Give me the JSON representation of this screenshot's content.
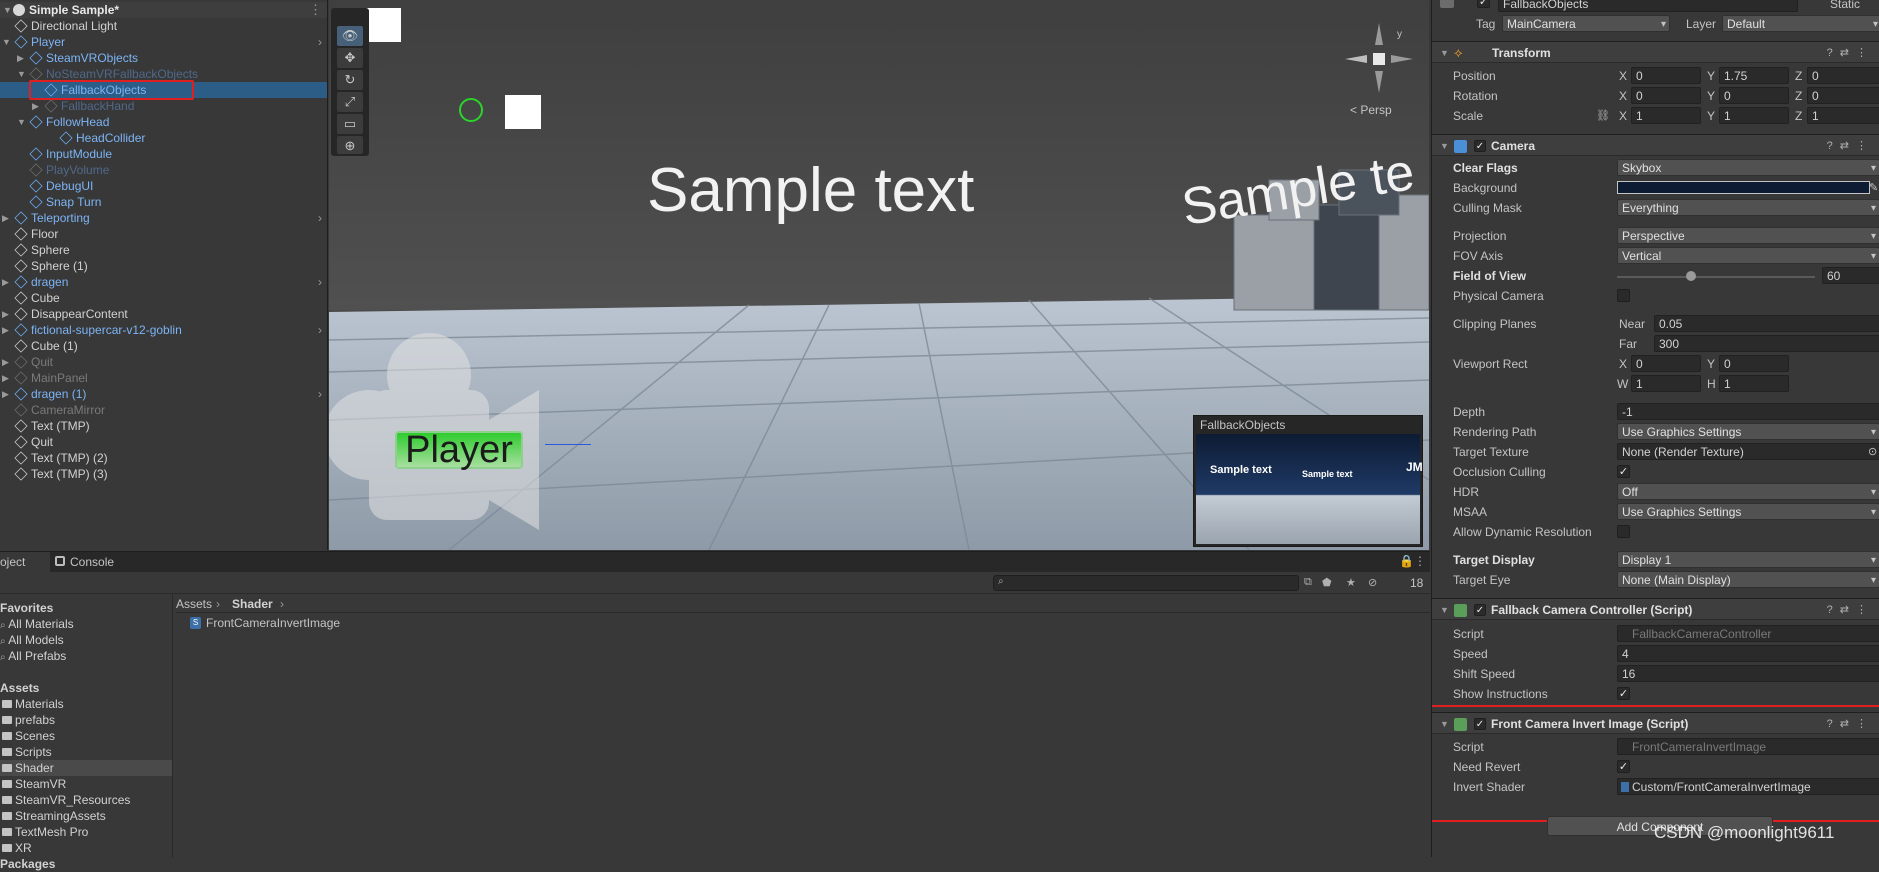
{
  "hierarchy": {
    "scene_name": "Simple Sample*",
    "items": [
      {
        "label": "Directional Light"
      },
      {
        "label": "Player"
      },
      {
        "label": "SteamVRObjects"
      },
      {
        "label": "NoSteamVRFallbackObjects"
      },
      {
        "label": "FallbackObjects"
      },
      {
        "label": "FallbackHand"
      },
      {
        "label": "FollowHead"
      },
      {
        "label": "HeadCollider"
      },
      {
        "label": "InputModule"
      },
      {
        "label": "PlayVolume"
      },
      {
        "label": "DebugUI"
      },
      {
        "label": "Snap Turn"
      },
      {
        "label": "Teleporting"
      },
      {
        "label": "Floor"
      },
      {
        "label": "Sphere"
      },
      {
        "label": "Sphere (1)"
      },
      {
        "label": "dragen"
      },
      {
        "label": "Cube"
      },
      {
        "label": "DisappearContent"
      },
      {
        "label": "fictional-supercar-v12-goblin"
      },
      {
        "label": "Cube (1)"
      },
      {
        "label": "Quit"
      },
      {
        "label": "MainPanel"
      },
      {
        "label": "dragen (1)"
      },
      {
        "label": "CameraMirror"
      },
      {
        "label": "Text (TMP)"
      },
      {
        "label": "Quit"
      },
      {
        "label": "Text (TMP) (2)"
      },
      {
        "label": "Text (TMP) (3)"
      }
    ]
  },
  "scene": {
    "sample_text_1": "Sample text",
    "sample_text_2": "Sample te",
    "persp_label": "< Persp",
    "player_label": "Player",
    "preview_title": "FallbackObjects",
    "preview_text_1": "Sample text",
    "preview_text_2": "Sample text",
    "preview_text_3": "JM"
  },
  "project": {
    "tabs": [
      "oject",
      "Console"
    ],
    "badge_count": "18",
    "favorites_title": "Favorites",
    "favorites": [
      "All Materials",
      "All Models",
      "All Prefabs"
    ],
    "assets_title": "Assets",
    "folders": [
      "Materials",
      "prefabs",
      "Scenes",
      "Scripts",
      "Shader",
      "SteamVR",
      "SteamVR_Resources",
      "StreamingAssets",
      "TextMesh Pro",
      "XR"
    ],
    "packages_title": "Packages",
    "breadcrumb": [
      "Assets",
      "Shader"
    ],
    "files": [
      "FrontCameraInvertImage"
    ]
  },
  "inspector": {
    "object_name": "FallbackObjects",
    "static_label": "Static",
    "tag_label": "Tag",
    "tag_value": "MainCamera",
    "layer_label": "Layer",
    "layer_value": "Default",
    "transform": {
      "title": "Transform",
      "position_label": "Position",
      "position": [
        "0",
        "1.75",
        "0"
      ],
      "rotation_label": "Rotation",
      "rotation": [
        "0",
        "0",
        "0"
      ],
      "scale_label": "Scale",
      "scale": [
        "1",
        "1",
        "1"
      ]
    },
    "camera": {
      "title": "Camera",
      "clear_flags_label": "Clear Flags",
      "clear_flags": "Skybox",
      "background_label": "Background",
      "culling_mask_label": "Culling Mask",
      "culling_mask": "Everything",
      "projection_label": "Projection",
      "projection": "Perspective",
      "fov_axis_label": "FOV Axis",
      "fov_axis": "Vertical",
      "fov_label": "Field of View",
      "fov": "60",
      "physical_label": "Physical Camera",
      "clipping_label": "Clipping Planes",
      "near_label": "Near",
      "near": "0.05",
      "far_label": "Far",
      "far": "300",
      "viewport_label": "Viewport Rect",
      "vx": "0",
      "vy": "0",
      "vw": "1",
      "vh": "1",
      "depth_label": "Depth",
      "depth": "-1",
      "rendering_path_label": "Rendering Path",
      "rendering_path": "Use Graphics Settings",
      "target_texture_label": "Target Texture",
      "target_texture": "None (Render Texture)",
      "occlusion_label": "Occlusion Culling",
      "hdr_label": "HDR",
      "hdr": "Off",
      "msaa_label": "MSAA",
      "msaa": "Use Graphics Settings",
      "dyn_res_label": "Allow Dynamic Resolution",
      "target_display_label": "Target Display",
      "target_display": "Display 1",
      "target_eye_label": "Target Eye",
      "target_eye": "None (Main Display)"
    },
    "fallback": {
      "title": "Fallback Camera Controller (Script)",
      "script_label": "Script",
      "script": "FallbackCameraController",
      "speed_label": "Speed",
      "speed": "4",
      "shift_label": "Shift Speed",
      "shift": "16",
      "show_label": "Show Instructions"
    },
    "invert": {
      "title": "Front Camera Invert Image (Script)",
      "script_label": "Script",
      "script": "FrontCameraInvertImage",
      "revert_label": "Need Revert",
      "shader_label": "Invert Shader",
      "shader": "Custom/FrontCameraInvertImage"
    },
    "add_component": "Add Component",
    "watermark": "CSDN @moonlight9611"
  },
  "colors": {
    "selection": "#2c5d87",
    "highlight_box": "#e02020",
    "prefab_text": "#7cb4f5",
    "panel": "#383838"
  }
}
